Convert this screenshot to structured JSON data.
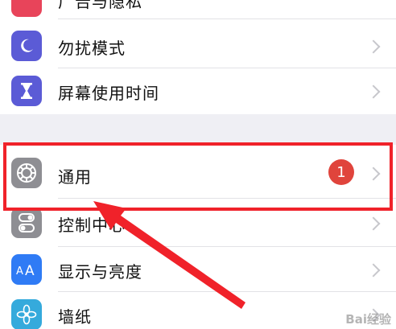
{
  "settings": {
    "partial_top_label": "广告与隐私",
    "items": [
      {
        "label": "勿扰模式",
        "icon": "moon-icon",
        "color": "#5b5bd6"
      },
      {
        "label": "屏幕使用时间",
        "icon": "hourglass-icon",
        "color": "#5b5bd6"
      },
      {
        "label": "通用",
        "icon": "gear-icon",
        "color": "#8e8e93",
        "badge": "1"
      },
      {
        "label": "控制中心",
        "icon": "toggle-switches-icon",
        "color": "#8e8e93"
      },
      {
        "label": "显示与亮度",
        "icon": "text-size-icon",
        "color": "#2f7bf5"
      },
      {
        "label": "墙纸",
        "icon": "flower-icon",
        "color": "#35aadc"
      }
    ]
  },
  "annotation": {
    "highlight_color": "#f0222a",
    "arrow_color": "#f0222a"
  },
  "watermark": {
    "text": "Bai经验"
  }
}
